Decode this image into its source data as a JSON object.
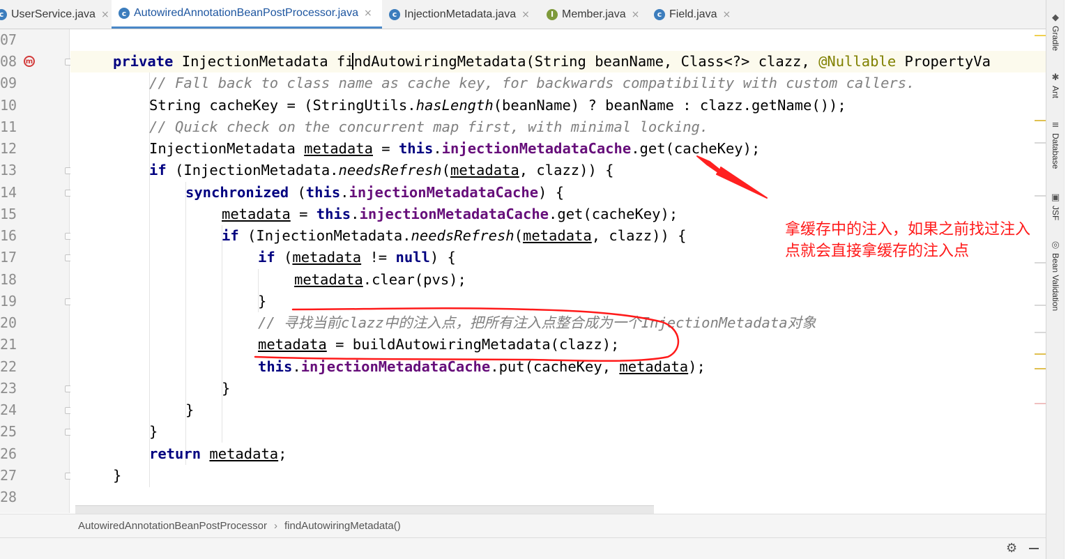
{
  "tabs": [
    {
      "label": "UserService.java",
      "icon": "java-class-icon",
      "active": false
    },
    {
      "label": "AutowiredAnnotationBeanPostProcessor.java",
      "icon": "java-class-icon",
      "active": true
    },
    {
      "label": "InjectionMetadata.java",
      "icon": "java-class-icon",
      "active": false
    },
    {
      "label": "Member.java",
      "icon": "java-interface-icon",
      "active": false
    },
    {
      "label": "Field.java",
      "icon": "java-class-icon",
      "active": false
    }
  ],
  "close_glyph": "×",
  "line_numbers": [
    "07",
    "08",
    "09",
    "10",
    "11",
    "12",
    "13",
    "14",
    "15",
    "16",
    "17",
    "18",
    "19",
    "20",
    "21",
    "22",
    "23",
    "24",
    "25",
    "26",
    "27",
    "28"
  ],
  "code": {
    "l08": {
      "kw": "private",
      "type": "InjectionMetadata",
      "method": "findAutowiringMetadata",
      "params_a": "(String beanName, Class<?> clazz, ",
      "ann": "@Nullable",
      "params_b": " PropertyVa"
    },
    "l09": "// Fall back to class name as cache key, for backwards compatibility with custom callers.",
    "l10": {
      "a": "String cacheKey = (StringUtils.",
      "static": "hasLength",
      "b": "(beanName) ? beanName : clazz.getName());"
    },
    "l11": "// Quick check on the concurrent map first, with minimal locking.",
    "l12": {
      "type": "InjectionMetadata ",
      "var": "metadata",
      "eq": " = ",
      "this": "this",
      "dot": ".",
      "field": "injectionMetadataCache",
      "rest": ".get(cacheKey);"
    },
    "l13": {
      "kw": "if",
      "a": " (InjectionMetadata.",
      "static": "needsRefresh",
      "b": "(",
      "var": "metadata",
      "c": ", clazz)) {"
    },
    "l14": {
      "kw": "synchronized",
      "a": " (",
      "this": "this",
      "dot": ".",
      "field": "injectionMetadataCache",
      "b": ") {"
    },
    "l15": {
      "var": "metadata",
      "eq": " = ",
      "this": "this",
      "dot": ".",
      "field": "injectionMetadataCache",
      "rest": ".get(cacheKey);"
    },
    "l16": {
      "kw": "if",
      "a": " (InjectionMetadata.",
      "static": "needsRefresh",
      "b": "(",
      "var": "metadata",
      "c": ", clazz)) {"
    },
    "l17": {
      "kw": "if",
      "a": " (",
      "var": "metadata",
      "b": " != ",
      "null": "null",
      "c": ") {"
    },
    "l18": {
      "var": "metadata",
      "rest": ".clear(pvs);"
    },
    "l19": "}",
    "l20": "// 寻找当前clazz中的注入点，把所有注入点整合成为一个InjectionMetadata对象",
    "l21": {
      "var": "metadata",
      "rest": " = buildAutowiringMetadata(clazz);"
    },
    "l22": {
      "this": "this",
      "dot": ".",
      "field": "injectionMetadataCache",
      "a": ".put(cacheKey, ",
      "var": "metadata",
      "b": ");"
    },
    "l23": "}",
    "l24": "}",
    "l25": "}",
    "l26": {
      "kw": "return",
      "a": " ",
      "var": "metadata",
      "b": ";"
    },
    "l27": "}"
  },
  "annotation_text": {
    "line1": "拿缓存中的注入，如果之前找过注入",
    "line2": "点就会直接拿缓存的注入点"
  },
  "annotation_color": "#ff1a1a",
  "method_marker": "m",
  "breadcrumb": {
    "class_name": "AutowiredAnnotationBeanPostProcessor",
    "separator": "›",
    "method_name": "findAutowiringMetadata()"
  },
  "tool_windows": [
    {
      "label": "Gradle",
      "icon": "gradle-icon"
    },
    {
      "label": "Ant",
      "icon": "ant-icon"
    },
    {
      "label": "Database",
      "icon": "database-icon"
    },
    {
      "label": "JSF",
      "icon": "jsf-icon"
    },
    {
      "label": "Bean Validation",
      "icon": "bean-validation-icon"
    }
  ],
  "colors": {
    "keyword": "#000080",
    "field": "#660e7a",
    "annotation": "#808000",
    "comment": "#808080",
    "active_tab": "#4a88c7"
  }
}
